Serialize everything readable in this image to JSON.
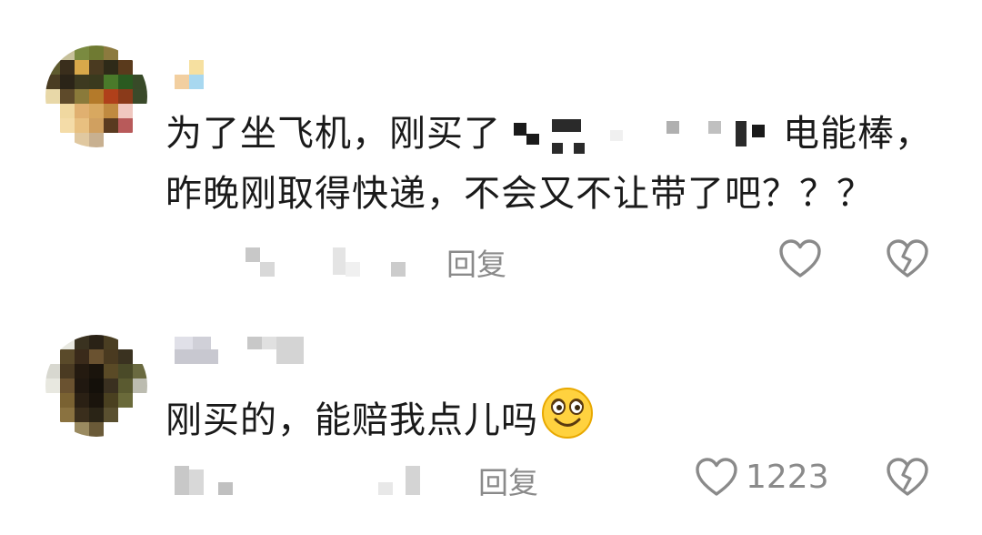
{
  "comments": [
    {
      "line1_start": "为了坐飞机，刚买了",
      "line1_end": "电能棒，",
      "line2": "昨晚刚取得快递，不会又不让带了吧？？？",
      "reply_label": "回复"
    },
    {
      "text": "刚买的，能赔我点儿吗",
      "emoji": "smiling-face-emoji",
      "reply_label": "回复",
      "like_count": "1223"
    }
  ],
  "icons": {
    "like": "heart-outline-icon",
    "dislike": "broken-heart-icon"
  },
  "colors": {
    "text": "#1a1a1a",
    "meta": "#8a8a8a",
    "emoji_fill": "#ffd23f"
  }
}
